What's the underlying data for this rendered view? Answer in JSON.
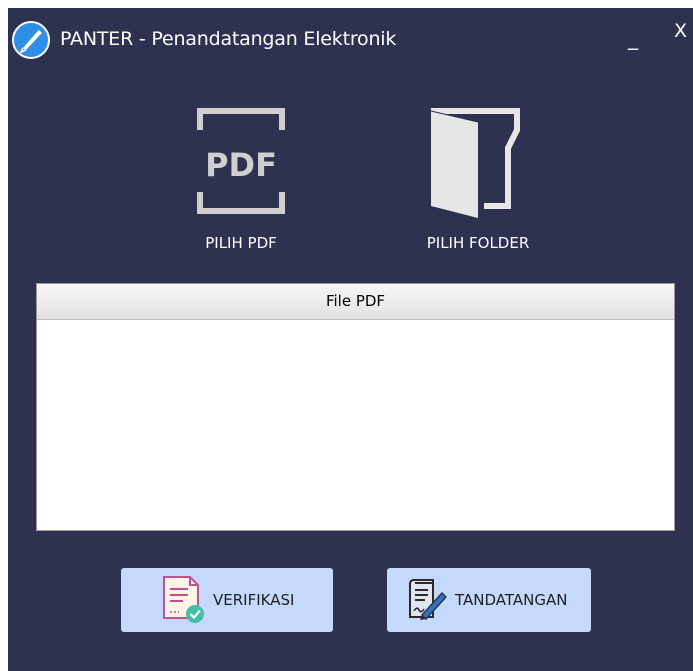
{
  "window": {
    "title": "PANTER - Penandatangan Elektronik",
    "minimize_label": "_",
    "close_label": "X",
    "background": "#2e3150"
  },
  "toolbar": {
    "pick_pdf": {
      "label": "PILIH PDF",
      "icon": "pdf-document-icon"
    },
    "pick_folder": {
      "label": "PILIH FOLDER",
      "icon": "open-folder-icon"
    }
  },
  "file_table": {
    "columns": [
      "File PDF"
    ],
    "rows": []
  },
  "actions": {
    "verify": {
      "label": "VERIFIKASI",
      "icon": "verify-document-icon"
    },
    "sign": {
      "label": "TANDATANGAN",
      "icon": "sign-document-icon"
    },
    "button_color": "#c4d9fb"
  }
}
